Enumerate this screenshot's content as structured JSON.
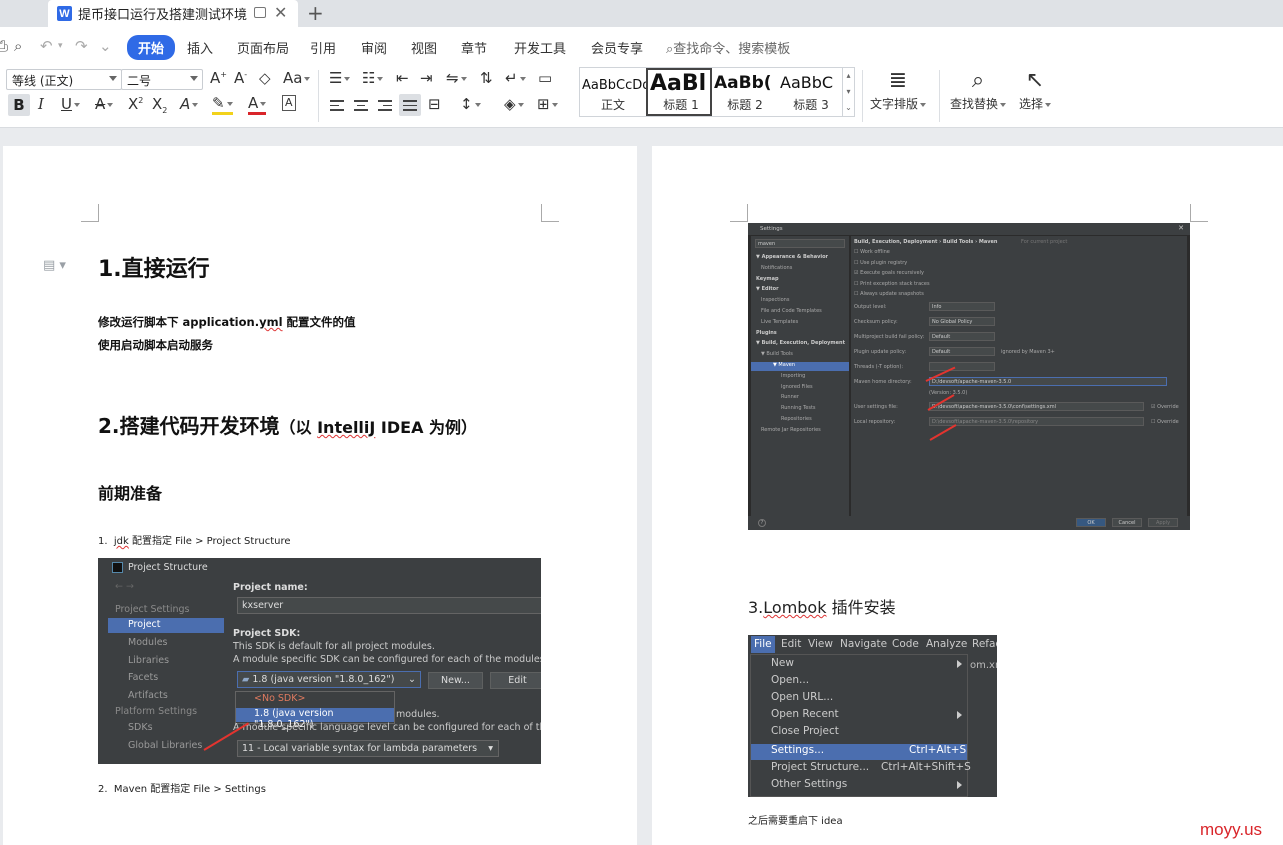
{
  "tab": {
    "icon_letter": "W",
    "title": "提币接口运行及搭建测试环境",
    "close": "✕",
    "add": "+"
  },
  "menu": {
    "items": [
      "开始",
      "插入",
      "页面布局",
      "引用",
      "审阅",
      "视图",
      "章节",
      "开发工具",
      "会员专享"
    ],
    "search_placeholder": "查找命令、搜索模板"
  },
  "ribbon": {
    "font_name": "等线 (正文)",
    "font_size": "二号",
    "styles": [
      {
        "sample": "AaBbCcDd",
        "label": "正文"
      },
      {
        "sample": "AaBl",
        "label": "标题 1"
      },
      {
        "sample": "AaBb(",
        "label": "标题 2"
      },
      {
        "sample": "AaBbC",
        "label": "标题 3"
      }
    ],
    "text_layout": "文字排版",
    "find_replace": "查找替换",
    "select": "选择"
  },
  "doc_left": {
    "h1": "1.直接运行",
    "p1_prefix": "修改运行脚本下 application.",
    "p1_yml": "yml",
    "p1_suffix": " 配置文件的值",
    "p2": "使用启动脚本启动服务",
    "h2_main": "2.搭建代码开发环境",
    "h2_sub_prefix": "（以 ",
    "h2_intellij": "IntelliJ",
    "h2_sub_suffix": " IDEA 为例）",
    "h3": "前期准备",
    "item1_num": "1.",
    "item1_jdk": "jdk",
    "item1_text": " 配置指定 File > Project Structure",
    "item2_num": "2.",
    "item2_text": "Maven  配置指定  File > Settings"
  },
  "project_structure": {
    "title": "Project Structure",
    "nav_arrows": "←  →",
    "sections": [
      "Project Settings",
      "Platform Settings"
    ],
    "project_items": [
      "Project",
      "Modules",
      "Libraries",
      "Facets",
      "Artifacts"
    ],
    "platform_items": [
      "SDKs",
      "Global Libraries"
    ],
    "name_label": "Project name:",
    "name_value": "kxserver",
    "sdk_label": "Project SDK:",
    "sdk_desc1": "This SDK is default for all project modules.",
    "sdk_desc2": "A module specific SDK can be configured for each of the modules as",
    "sdk_value": "1.8 (java version \"1.8.0_162\")",
    "new_btn": "New...",
    "edit_btn": "Edit",
    "dd_no_sdk": "<No SDK>",
    "dd_sdk": "1.8 (java version \"1.8.0_162\")",
    "behind_text1": "modules.",
    "behind_text2": "A module specific language level can be configured for each of the m",
    "lang_level": "11 - Local variable syntax for lambda parameters"
  },
  "settings_dialog": {
    "title": "Settings",
    "search": "maven",
    "breadcrumb": "Build, Execution, Deployment  ›  Build Tools  ›  Maven",
    "breadcrumb_hint": "For current project",
    "tree": [
      {
        "text": "▼ Appearance & Behavior",
        "kind": "b"
      },
      {
        "text": "Notifications",
        "kind": ""
      },
      {
        "text": "Keymap",
        "kind": "b"
      },
      {
        "text": "▼ Editor",
        "kind": "b"
      },
      {
        "text": "Inspections",
        "kind": ""
      },
      {
        "text": "File and Code Templates",
        "kind": ""
      },
      {
        "text": "Live Templates",
        "kind": ""
      },
      {
        "text": "Plugins",
        "kind": "b"
      },
      {
        "text": "▼ Build, Execution, Deployment",
        "kind": "b"
      },
      {
        "text": "▼ Build Tools",
        "kind": ""
      },
      {
        "text": "▼ Maven",
        "kind": "sel"
      },
      {
        "text": "Importing",
        "kind": "i"
      },
      {
        "text": "Ignored Files",
        "kind": "i"
      },
      {
        "text": "Runner",
        "kind": "i"
      },
      {
        "text": "Running Tests",
        "kind": "i"
      },
      {
        "text": "Repositories",
        "kind": "i"
      },
      {
        "text": "Remote Jar Repositories",
        "kind": ""
      }
    ],
    "checks": [
      "Work offline",
      "Use plugin registry",
      "Execute goals recursively",
      "Print exception stack traces",
      "Always update snapshots"
    ],
    "output_level_label": "Output level:",
    "output_level": "Info",
    "checksum_label": "Checksum policy:",
    "checksum": "No Global Policy",
    "multiproj_label": "Multiproject build fail policy:",
    "multiproj": "Default",
    "plugin_update_label": "Plugin update policy:",
    "plugin_update": "Default",
    "plugin_update_hint": "ignored by Maven 3+",
    "threads_label": "Threads (-T option):",
    "home_label": "Maven home directory:",
    "home_value": "D:/devsoft/apache-maven-3.5.0",
    "version": "(Version: 3.5.0)",
    "user_settings_label": "User settings file:",
    "user_settings": "D:\\devsoft\\apache-maven-3.5.0\\conf\\settings.xml",
    "local_repo_label": "Local repository:",
    "local_repo": "D:\\devsoft\\apache-maven-3.5.0\\repository",
    "override": "Override",
    "help": "?",
    "ok": "OK",
    "cancel": "Cancel",
    "apply": "Apply"
  },
  "doc_right": {
    "h3_num": "3.",
    "h3_word": "Lombok",
    "h3_rest": "  插件安装",
    "after": "之后需要重启下  idea"
  },
  "file_menu": {
    "bar": [
      "File",
      "Edit",
      "View",
      "Navigate",
      "Code",
      "Analyze",
      "Refac"
    ],
    "behind": "om.xm",
    "items": [
      {
        "label": "New",
        "shortcut": "",
        "submenu": true
      },
      {
        "label": "Open...",
        "shortcut": "",
        "submenu": false
      },
      {
        "label": "Open URL...",
        "shortcut": "",
        "submenu": false
      },
      {
        "label": "Open Recent",
        "shortcut": "",
        "submenu": true
      },
      {
        "label": "Close Project",
        "shortcut": "",
        "submenu": false
      },
      {
        "label": "Settings...",
        "shortcut": "Ctrl+Alt+S",
        "submenu": false
      },
      {
        "label": "Project Structure...",
        "shortcut": "Ctrl+Alt+Shift+S",
        "submenu": false
      },
      {
        "label": "Other Settings",
        "shortcut": "",
        "submenu": true
      }
    ]
  },
  "watermark": "moyy.us",
  "colors": {
    "accent": "#2f6ae6",
    "ide_bg": "#3c3f41",
    "ide_select": "#4b6eaf",
    "watermark": "#d9252a"
  }
}
